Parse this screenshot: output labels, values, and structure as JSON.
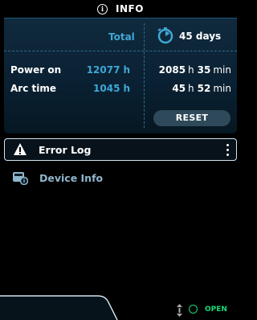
{
  "header": {
    "title": "INFO",
    "icon": "info-icon"
  },
  "stats": {
    "total_label": "Total",
    "elapsed_label": "45 days",
    "rows": [
      {
        "label": "Power on",
        "total": "12077",
        "total_unit": "h",
        "hours": "2085",
        "hours_unit": "h",
        "minutes": "35",
        "minutes_unit": "min"
      },
      {
        "label": "Arc time",
        "total": "1045",
        "total_unit": "h",
        "hours": "45",
        "hours_unit": "h",
        "minutes": "52",
        "minutes_unit": "min"
      }
    ],
    "reset_label": "RESET"
  },
  "menu": [
    {
      "label": "Error Log",
      "icon": "warning-icon",
      "selected": true
    },
    {
      "label": "Device Info",
      "icon": "device-info-icon",
      "selected": false
    }
  ],
  "footer": {
    "status_label": "OPEN",
    "status_color": "#16d97a"
  },
  "colors": {
    "accent": "#3fa7d6",
    "panel": "#0a2133",
    "background": "#000000"
  }
}
